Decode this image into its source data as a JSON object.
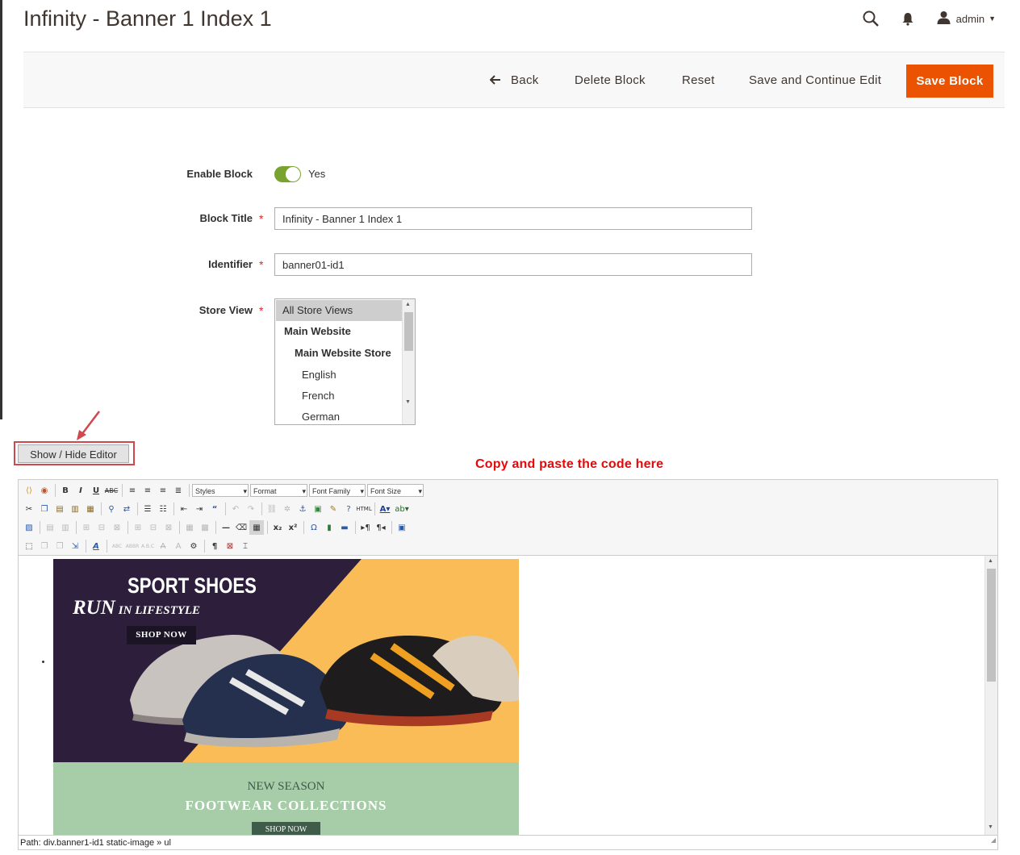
{
  "header": {
    "title": "Infinity - Banner 1 Index 1",
    "user": "admin"
  },
  "actions": {
    "back": "Back",
    "delete": "Delete Block",
    "reset": "Reset",
    "save_continue": "Save and Continue Edit",
    "save": "Save Block"
  },
  "form": {
    "enable_label": "Enable Block",
    "enable_value": "Yes",
    "title_label": "Block Title",
    "title_value": "Infinity - Banner 1 Index 1",
    "identifier_label": "Identifier",
    "identifier_value": "banner01-id1",
    "store_label": "Store View",
    "store_options": [
      "All Store Views",
      "Main Website",
      "Main Website Store",
      "English",
      "French",
      "German"
    ],
    "store_selected": "All Store Views"
  },
  "editor": {
    "toggle_label": "Show / Hide Editor",
    "annotation": "Copy and paste the code here",
    "dropdowns": {
      "styles": "Styles",
      "format": "Format",
      "font_family": "Font Family",
      "font_size": "Font Size"
    },
    "path": "Path: div.banner1-id1 static-image » ul",
    "banner1": {
      "title": "SPORT SHOES",
      "subtitle_big": "RUN",
      "subtitle_small": "IN LIFESTYLE",
      "button": "SHOP NOW"
    },
    "banner2": {
      "line1": "NEW SEASON",
      "line2": "FOOTWEAR COLLECTIONS",
      "button": "SHOP NOW"
    }
  },
  "colors": {
    "primary_button": "#eb5202",
    "toggle_on": "#79a22e",
    "required": "#e22626",
    "annotation": "#e00b0b",
    "highlight_box": "#d0474e"
  }
}
